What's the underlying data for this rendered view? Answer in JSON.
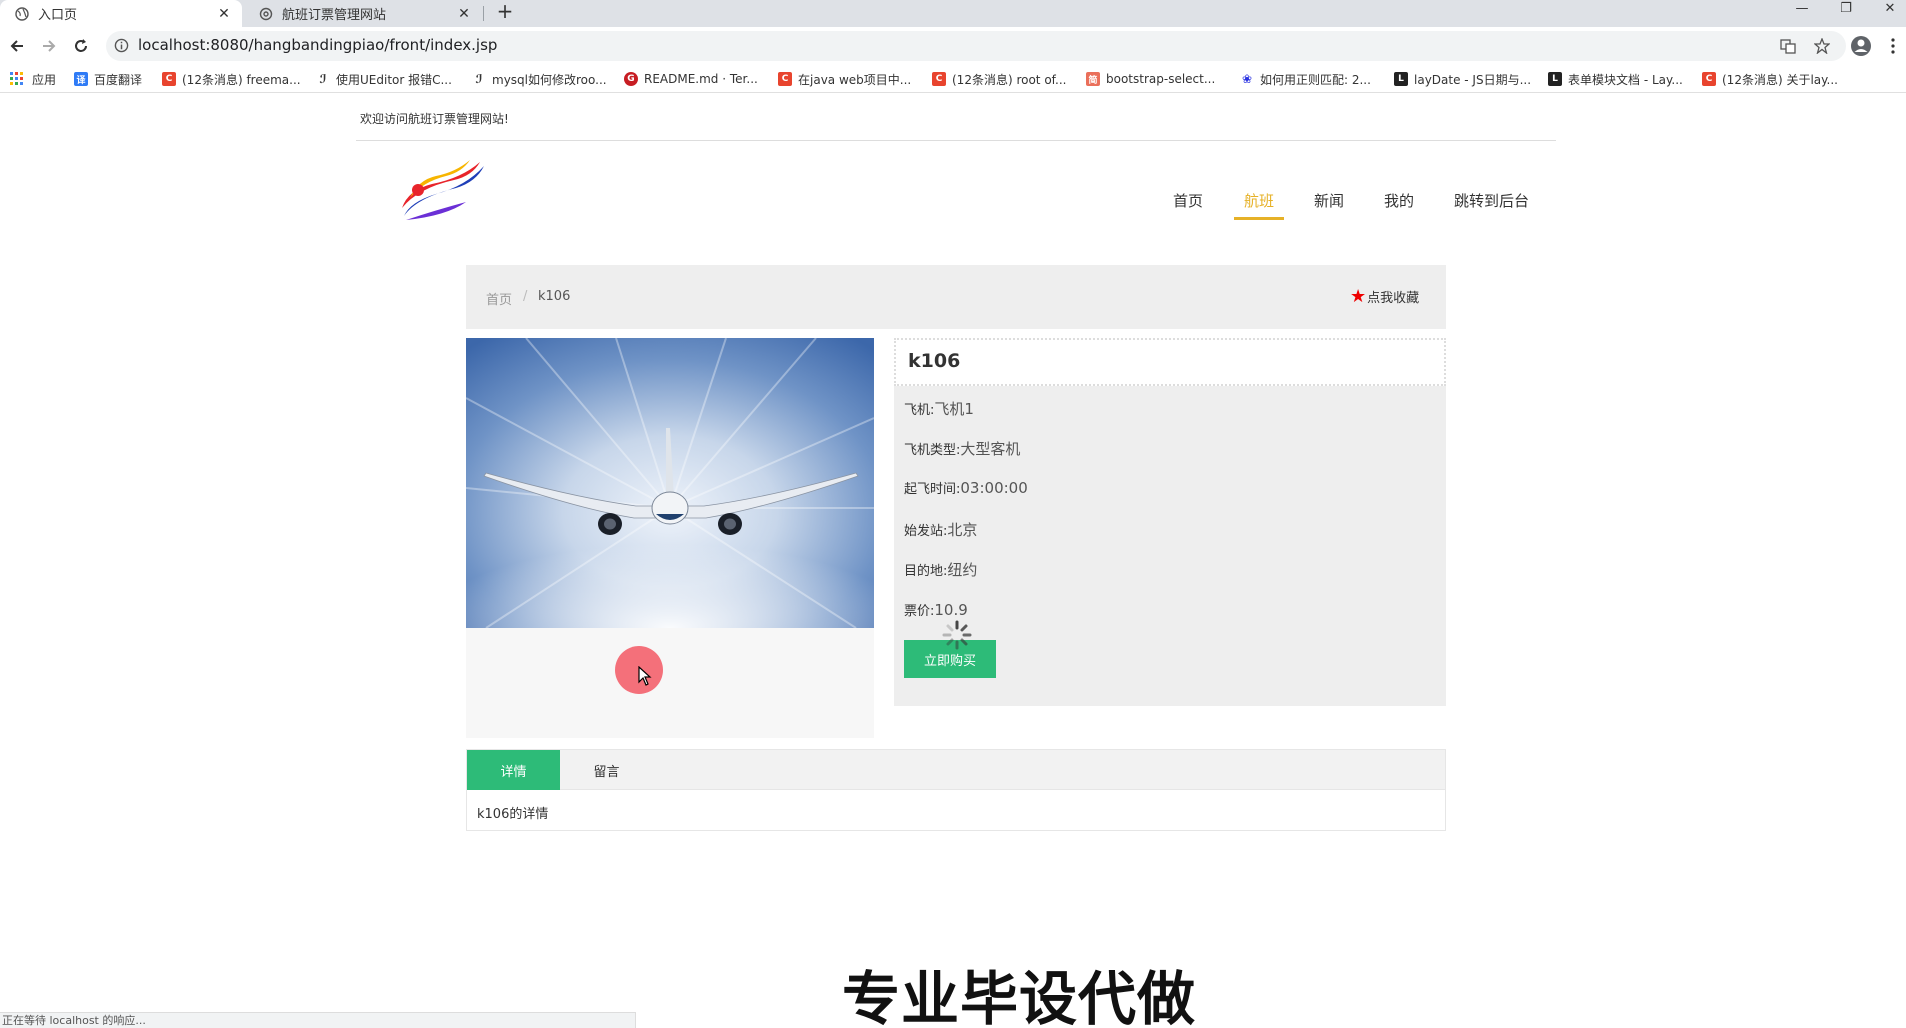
{
  "browser": {
    "tabs": [
      {
        "label": "入口页",
        "active": true
      },
      {
        "label": "航班订票管理网站",
        "active": false
      }
    ],
    "url": "localhost:8080/hangbandingpiao/front/index.jsp",
    "bookmarks": [
      {
        "label": "应用",
        "icon": "apps-grid-icon",
        "color": "#4285f4"
      },
      {
        "label": "百度翻译",
        "icon": "baidu-translate-icon",
        "color": "#2f7bf6"
      },
      {
        "label": "(12条消息) freema...",
        "icon": "csdn-icon",
        "color": "#e8442e"
      },
      {
        "label": "使用UEditor 报错C...",
        "icon": "cnblogs-icon",
        "color": "#333333"
      },
      {
        "label": "mysql如何修改roo...",
        "icon": "cnblogs-icon",
        "color": "#333333"
      },
      {
        "label": "README.md · Ter...",
        "icon": "gitee-icon",
        "color": "#c71d23"
      },
      {
        "label": "在java web项目中...",
        "icon": "csdn-icon",
        "color": "#e8442e"
      },
      {
        "label": "(12条消息) root of...",
        "icon": "csdn-icon",
        "color": "#e8442e"
      },
      {
        "label": "bootstrap-select...",
        "icon": "jianshu-icon",
        "color": "#ea6f5a"
      },
      {
        "label": "如何用正则匹配: 2...",
        "icon": "baidu-paw-icon",
        "color": "#2932e1"
      },
      {
        "label": "layDate - JS日期与...",
        "icon": "layui-icon",
        "color": "#222222"
      },
      {
        "label": "表单模块文档 - Lay...",
        "icon": "layui-icon",
        "color": "#222222"
      },
      {
        "label": "(12条消息) 关于lay...",
        "icon": "csdn-icon",
        "color": "#e8442e"
      }
    ],
    "status_text": "正在等待 localhost 的响应..."
  },
  "site": {
    "welcome": "欢迎访问航班订票管理网站!",
    "nav": [
      "首页",
      "航班",
      "新闻",
      "我的",
      "跳转到后台"
    ],
    "active_nav": "航班"
  },
  "breadcrumb": {
    "home": "首页",
    "sep": "/",
    "current": "k106",
    "favorite": "点我收藏"
  },
  "flight": {
    "title": "k106",
    "fields": [
      {
        "label": "飞机:",
        "value": "飞机1"
      },
      {
        "label": "飞机类型:",
        "value": "大型客机"
      },
      {
        "label": "起飞时间:",
        "value": "03:00:00"
      },
      {
        "label": "始发站:",
        "value": "北京"
      },
      {
        "label": "目的地:",
        "value": "纽约"
      },
      {
        "label": "票价:",
        "value": "10.9"
      }
    ],
    "buy_label": "立即购买"
  },
  "detail_tabs": {
    "tabs": [
      "详情",
      "留言"
    ],
    "active": "详情",
    "content": "k106的详情"
  },
  "overlay": {
    "watermark": "专业毕设代做"
  },
  "colors": {
    "accent_green": "#2dbb78",
    "nav_active": "#e6b127",
    "star_red": "#ee0000"
  }
}
